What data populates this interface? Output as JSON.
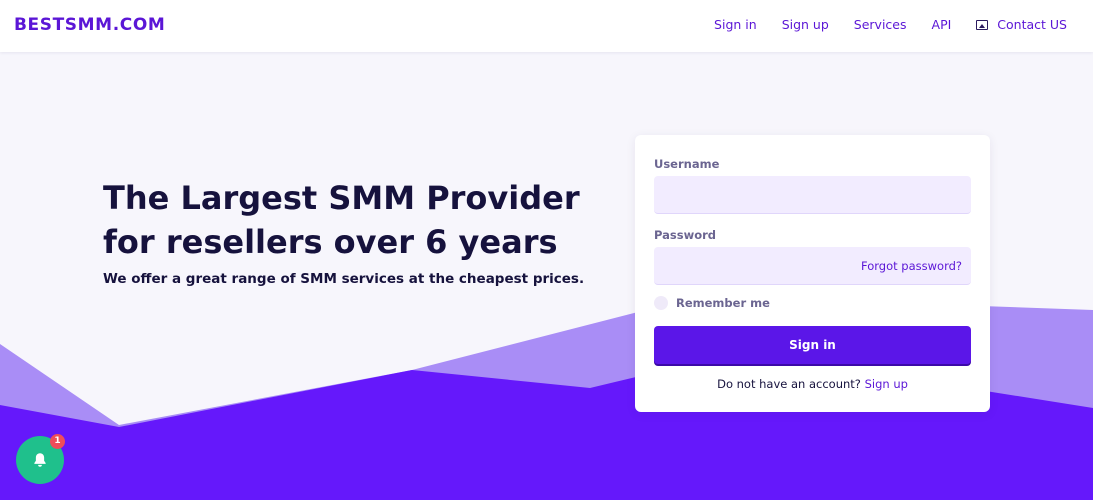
{
  "header": {
    "brand": "BESTSMM.COM",
    "nav": {
      "sign_in": "Sign in",
      "sign_up": "Sign up",
      "services": "Services",
      "api": "API",
      "contact": "Contact US"
    }
  },
  "hero": {
    "title": "The Largest SMM Provider for resellers over 6 years",
    "subtitle": "We offer a great range of SMM services at the cheapest prices."
  },
  "login": {
    "username_label": "Username",
    "username_value": "",
    "password_label": "Password",
    "password_value": "",
    "forgot_password": "Forgot password?",
    "remember_me": "Remember me",
    "remember_checked": false,
    "submit": "Sign in",
    "no_account_text": "Do not have an account?",
    "signup_link": "Sign up"
  },
  "notifications": {
    "icon": "bell-icon",
    "badge_count": "1"
  },
  "colors": {
    "brand": "#5b16d6",
    "primary_button": "#5b16e8",
    "wave_light": "#a98df6",
    "wave_dark": "#6518fb",
    "bell": "#1fc08c",
    "badge": "#ef4d5a"
  }
}
